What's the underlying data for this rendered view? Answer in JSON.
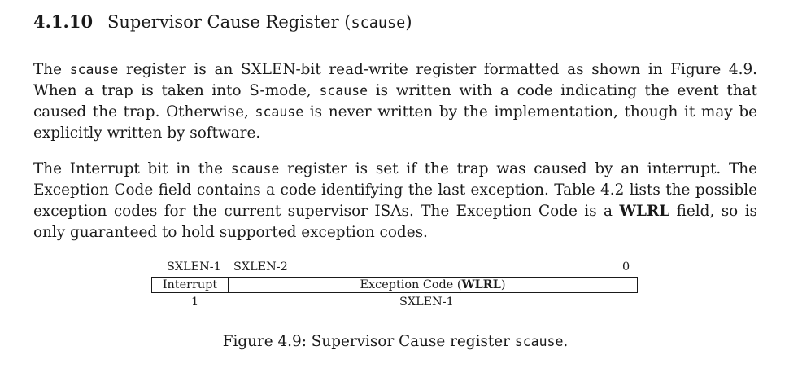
{
  "section": {
    "number": "4.1.10",
    "title": "Supervisor Cause Register (",
    "title_code": "scause",
    "title_end": ")"
  },
  "paragraph1": {
    "t1": "The ",
    "c1": "scause",
    "t2": " register is an SXLEN-bit read-write register formatted as shown in Figure 4.9. When a trap is taken into S-mode, ",
    "c2": "scause",
    "t3": " is written with a code indicating the event that caused the trap. Otherwise, ",
    "c3": "scause",
    "t4": " is never written by the implementation, though it may be explicitly written by software."
  },
  "paragraph2": {
    "t1": "The Interrupt bit in the ",
    "c1": "scause",
    "t2": " register is set if the trap was caused by an interrupt. The Exception Code field contains a code identifying the last exception. Table 4.2 lists the possible exception codes for the current supervisor ISAs. The Exception Code is a ",
    "b1": "WLRL",
    "t3": " field, so is only guaranteed to hold supported exception codes."
  },
  "register": {
    "bit_high": "SXLEN-1",
    "bit_next": "SXLEN-2",
    "bit_low": "0",
    "field_interrupt": "Interrupt",
    "field_exception": "Exception Code (",
    "field_exception_bold": "WLRL",
    "field_exception_end": ")",
    "width_interrupt": "1",
    "width_exception": "SXLEN-1"
  },
  "caption": {
    "text": "Figure 4.9: Supervisor Cause register ",
    "code": "scause",
    "end": "."
  }
}
